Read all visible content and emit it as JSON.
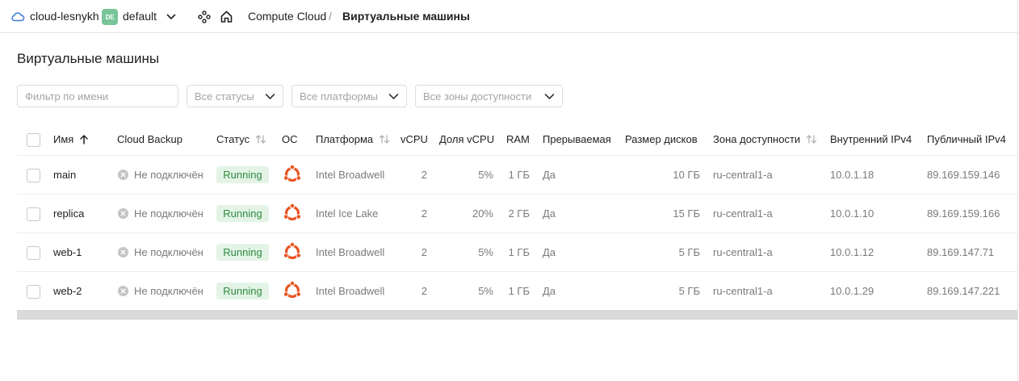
{
  "header": {
    "cloud_name": "cloud-lesnykh",
    "folder_badge": "DE",
    "folder_name": "default",
    "breadcrumb_service": "Compute Cloud",
    "breadcrumb_separator": "/",
    "breadcrumb_current": "Виртуальные машины"
  },
  "page": {
    "title": "Виртуальные машины"
  },
  "filters": {
    "name_placeholder": "Фильтр по имени",
    "status_select": "Все статусы",
    "platform_select": "Все платформы",
    "zone_select": "Все зоны доступности"
  },
  "table": {
    "columns": {
      "name": "Имя",
      "backup": "Cloud Backup",
      "status": "Статус",
      "os": "ОС",
      "platform": "Платформа",
      "vcpu": "vCPU",
      "vcpu_share": "Доля vCPU",
      "ram": "RAM",
      "preemptible": "Прерываемая",
      "disk_size": "Размер дисков",
      "zone": "Зона доступности",
      "internal_ip": "Внутренний IPv4",
      "public_ip": "Публичный IPv4"
    },
    "rows": [
      {
        "name": "main",
        "backup": "Не подключён",
        "status": "Running",
        "platform": "Intel Broadwell",
        "vcpu": "2",
        "vcpu_share": "5%",
        "ram": "1 ГБ",
        "preemptible": "Да",
        "disk_size": "10 ГБ",
        "zone": "ru-central1-a",
        "internal_ip": "10.0.1.18",
        "public_ip": "89.169.159.146"
      },
      {
        "name": "replica",
        "backup": "Не подключён",
        "status": "Running",
        "platform": "Intel Ice Lake",
        "vcpu": "2",
        "vcpu_share": "20%",
        "ram": "2 ГБ",
        "preemptible": "Да",
        "disk_size": "15 ГБ",
        "zone": "ru-central1-a",
        "internal_ip": "10.0.1.10",
        "public_ip": "89.169.159.166"
      },
      {
        "name": "web-1",
        "backup": "Не подключён",
        "status": "Running",
        "platform": "Intel Broadwell",
        "vcpu": "2",
        "vcpu_share": "5%",
        "ram": "1 ГБ",
        "preemptible": "Да",
        "disk_size": "5 ГБ",
        "zone": "ru-central1-a",
        "internal_ip": "10.0.1.12",
        "public_ip": "89.169.147.71"
      },
      {
        "name": "web-2",
        "backup": "Не подключён",
        "status": "Running",
        "platform": "Intel Broadwell",
        "vcpu": "2",
        "vcpu_share": "5%",
        "ram": "1 ГБ",
        "preemptible": "Да",
        "disk_size": "5 ГБ",
        "zone": "ru-central1-a",
        "internal_ip": "10.0.1.29",
        "public_ip": "89.169.147.221"
      }
    ]
  },
  "icons": {
    "cloud": "cloud-icon",
    "chevron": "chevron-down-icon",
    "services": "services-icon",
    "home": "home-icon",
    "backup": "backup-disconnected-icon",
    "os": "ubuntu-icon",
    "sort": "sort-icon"
  },
  "colors": {
    "status_running_bg": "#e3f4e6",
    "status_running_text": "#2e8a3f",
    "folder_badge": "#79c49a",
    "cloud_icon": "#3d7ad6",
    "ubuntu": "#e95420"
  }
}
